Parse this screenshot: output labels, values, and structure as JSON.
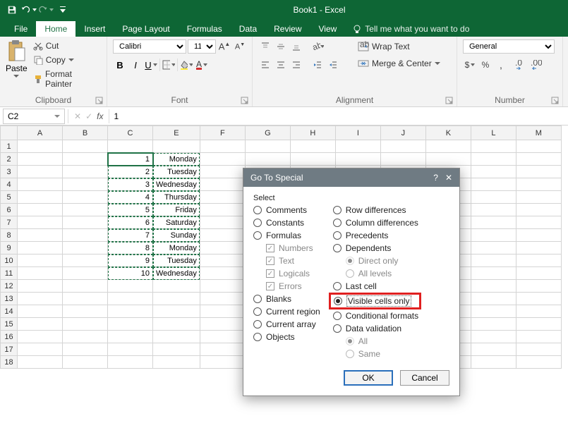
{
  "app": {
    "title": "Book1 - Excel"
  },
  "qat": {
    "save": "save",
    "undo": "undo",
    "redo": "redo"
  },
  "tabs": {
    "file": "File",
    "home": "Home",
    "insert": "Insert",
    "pagelayout": "Page Layout",
    "formulas": "Formulas",
    "data": "Data",
    "review": "Review",
    "view": "View",
    "tell": "Tell me what you want to do"
  },
  "ribbon": {
    "clipboard": {
      "paste": "Paste",
      "cut": "Cut",
      "copy": "Copy",
      "painter": "Format Painter",
      "label": "Clipboard"
    },
    "font": {
      "name": "Calibri",
      "size": "11",
      "label": "Font"
    },
    "alignment": {
      "wrap": "Wrap Text",
      "merge": "Merge & Center",
      "label": "Alignment"
    },
    "number": {
      "format": "General",
      "label": "Number"
    }
  },
  "formulabar": {
    "namebox": "C2",
    "fx": "fx",
    "value": "1"
  },
  "grid": {
    "cols": [
      "A",
      "B",
      "C",
      "E",
      "F",
      "G",
      "H",
      "I",
      "J",
      "K",
      "L",
      "M"
    ],
    "rows": [
      {
        "r": 1
      },
      {
        "r": 2,
        "c": "1",
        "e": "Monday"
      },
      {
        "r": 3,
        "c": "2",
        "e": "Tuesday"
      },
      {
        "r": 4,
        "c": "3",
        "e": "Wednesday"
      },
      {
        "r": 5,
        "c": "4",
        "e": "Thursday"
      },
      {
        "r": 6,
        "c": "5",
        "e": "Friday"
      },
      {
        "r": 7,
        "c": "6",
        "e": "Saturday"
      },
      {
        "r": 8,
        "c": "7",
        "e": "Sunday"
      },
      {
        "r": 9,
        "c": "8",
        "e": "Monday"
      },
      {
        "r": 10,
        "c": "9",
        "e": "Tuesday"
      },
      {
        "r": 11,
        "c": "10",
        "e": "Wednesday"
      },
      {
        "r": 12
      },
      {
        "r": 13
      },
      {
        "r": 14
      },
      {
        "r": 15
      },
      {
        "r": 16
      },
      {
        "r": 17
      },
      {
        "r": 18
      }
    ]
  },
  "dialog": {
    "title": "Go To Special",
    "select": "Select",
    "left": {
      "comments": "Comments",
      "constants": "Constants",
      "formulas": "Formulas",
      "numbers": "Numbers",
      "text": "Text",
      "logicals": "Logicals",
      "errors": "Errors",
      "blanks": "Blanks",
      "region": "Current region",
      "array": "Current array",
      "objects": "Objects"
    },
    "right": {
      "rowdiff": "Row differences",
      "coldiff": "Column differences",
      "precedents": "Precedents",
      "dependents": "Dependents",
      "direct": "Direct only",
      "alllev": "All levels",
      "lastcell": "Last cell",
      "visible": "Visible cells only",
      "condfmt": "Conditional formats",
      "dataval": "Data validation",
      "all": "All",
      "same": "Same"
    },
    "ok": "OK",
    "cancel": "Cancel"
  }
}
